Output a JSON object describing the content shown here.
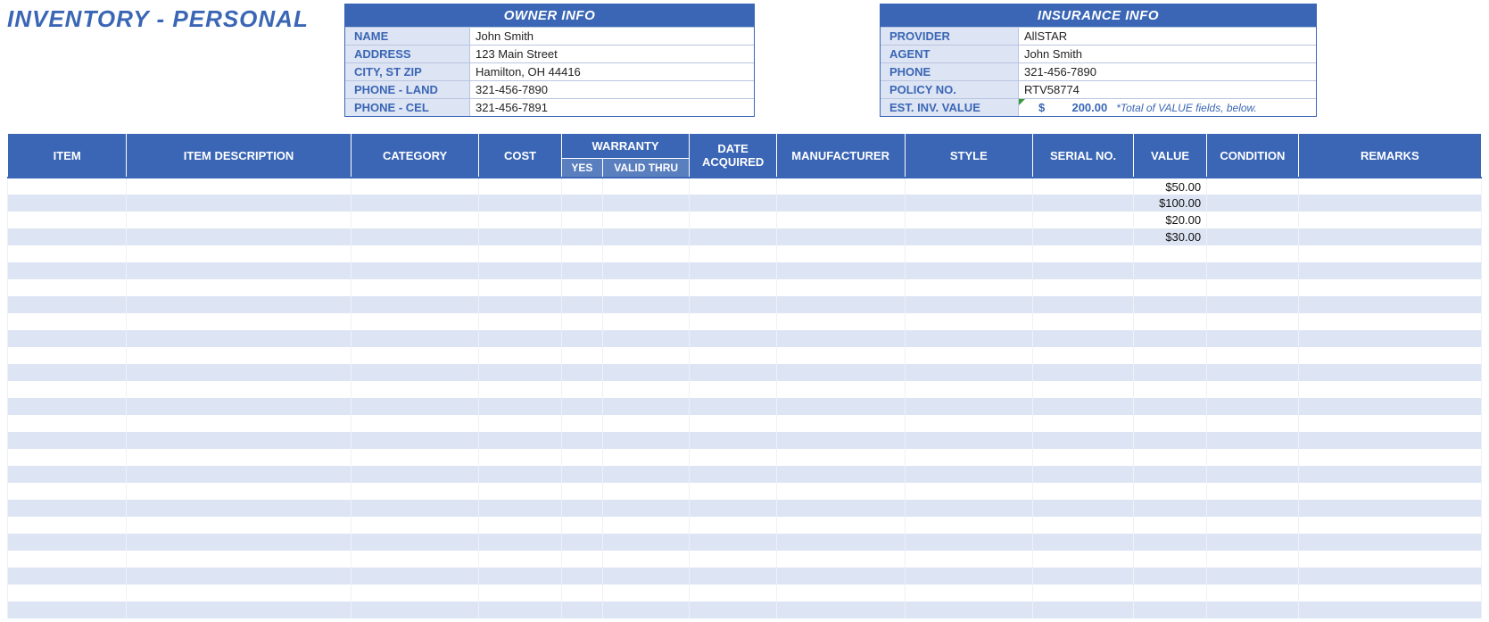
{
  "title": "INVENTORY - PERSONAL",
  "owner": {
    "header": "OWNER INFO",
    "labels": {
      "name": "NAME",
      "address": "ADDRESS",
      "citystzip": "CITY, ST  ZIP",
      "phone_land": "PHONE - LAND",
      "phone_cel": "PHONE - CEL"
    },
    "values": {
      "name": "John Smith",
      "address": "123 Main Street",
      "citystzip": "Hamilton, OH  44416",
      "phone_land": "321-456-7890",
      "phone_cel": "321-456-7891"
    }
  },
  "insurance": {
    "header": "INSURANCE INFO",
    "labels": {
      "provider": "PROVIDER",
      "agent": "AGENT",
      "phone": "PHONE",
      "policy": "POLICY NO.",
      "est": "EST. INV. VALUE"
    },
    "values": {
      "provider": "AllSTAR",
      "agent": "John Smith",
      "phone": "321-456-7890",
      "policy": "RTV58774"
    },
    "est_value": {
      "currency": "$",
      "amount": "200.00",
      "note": "*Total of VALUE fields, below."
    }
  },
  "columns": {
    "item": "ITEM",
    "desc": "ITEM DESCRIPTION",
    "cat": "CATEGORY",
    "cost": "COST",
    "warranty": "WARRANTY",
    "warranty_yes": "YES",
    "warranty_thru": "VALID THRU",
    "date": "DATE ACQUIRED",
    "manu": "MANUFACTURER",
    "style": "STYLE",
    "serial": "SERIAL NO.",
    "value": "VALUE",
    "cond": "CONDITION",
    "remarks": "REMARKS"
  },
  "rows": [
    {
      "value": "$50.00"
    },
    {
      "value": "$100.00"
    },
    {
      "value": "$20.00"
    },
    {
      "value": "$30.00"
    },
    {},
    {},
    {},
    {},
    {},
    {},
    {},
    {},
    {},
    {},
    {},
    {},
    {},
    {},
    {},
    {},
    {},
    {},
    {},
    {},
    {},
    {}
  ]
}
